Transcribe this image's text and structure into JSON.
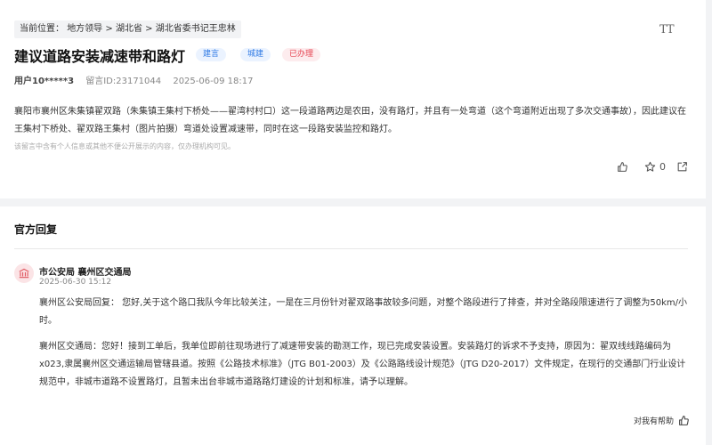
{
  "breadcrumb": {
    "label": "当前位置：",
    "items": [
      "地方领导",
      "湖北省",
      "湖北省委书记王忠林"
    ],
    "separator": ">"
  },
  "toolbar": {
    "font_size_icon": "font-size-icon",
    "font_size_label": "TT"
  },
  "post": {
    "title": "建议道路安装减速带和路灯",
    "tags": [
      {
        "label": "建言",
        "color": "#2f7ae5"
      },
      {
        "label": "城建",
        "color": "#2f7ae5"
      },
      {
        "label": "已办理",
        "color": "#e64553"
      }
    ],
    "user": "用户10*****3",
    "message_id": "留言ID:23171044",
    "datetime": "2025-06-09 18:17",
    "content": "襄阳市襄州区朱集镇翟双路（朱集镇王集村下桥处——翟湾村村口）这一段道路两边是农田，没有路灯，并且有一处弯道（这个弯道附近出现了多次交通事故），因此建议在王集村下桥处、翟双路王集村（图片拍摄）弯道处设置减速带，同时在这一段路安装监控和路灯。",
    "notice": "该留言中含有个人信息或其他不便公开展示的内容，仅办理机构可见。",
    "actions": {
      "like_icon": "thumbs-up-icon",
      "star_icon": "star-icon",
      "star_count": "0",
      "share_icon": "share-icon"
    }
  },
  "reply_section": {
    "title": "官方回复",
    "org": "市公安局 襄州区交通局",
    "avatar_icon": "government-building-icon",
    "datetime": "2025-06-30 15:12",
    "replies": [
      "襄州区公安局回复： 您好,关于这个路口我队今年比较关注，一是在三月份针对翟双路事故较多问题，对整个路段进行了排查，并对全路段限速进行了调整为50km/小时。",
      "襄州区交通局：您好！接到工单后，我单位即前往现场进行了减速带安装的勘测工作，现已完成安装设置。安装路灯的诉求不予支持，原因为：翟双线线路编码为x023,隶属襄州区交通运输局管辖县道。按照《公路技术标准》（JTG B01-2003）及《公路路线设计规范》（JTG D20-2017）文件规定，在现行的交通部门行业设计规范中，非城市道路不设置路灯，且暂未出台非城市道路路灯建设的计划和标准，请予以理解。"
    ],
    "helpful_label": "对我有帮助",
    "helpful_icon": "thumbs-up-icon"
  },
  "colors": {
    "accent_blue": "#2f7ae5",
    "done_red": "#e64553",
    "avatar_bg": "#fbe4e6"
  }
}
